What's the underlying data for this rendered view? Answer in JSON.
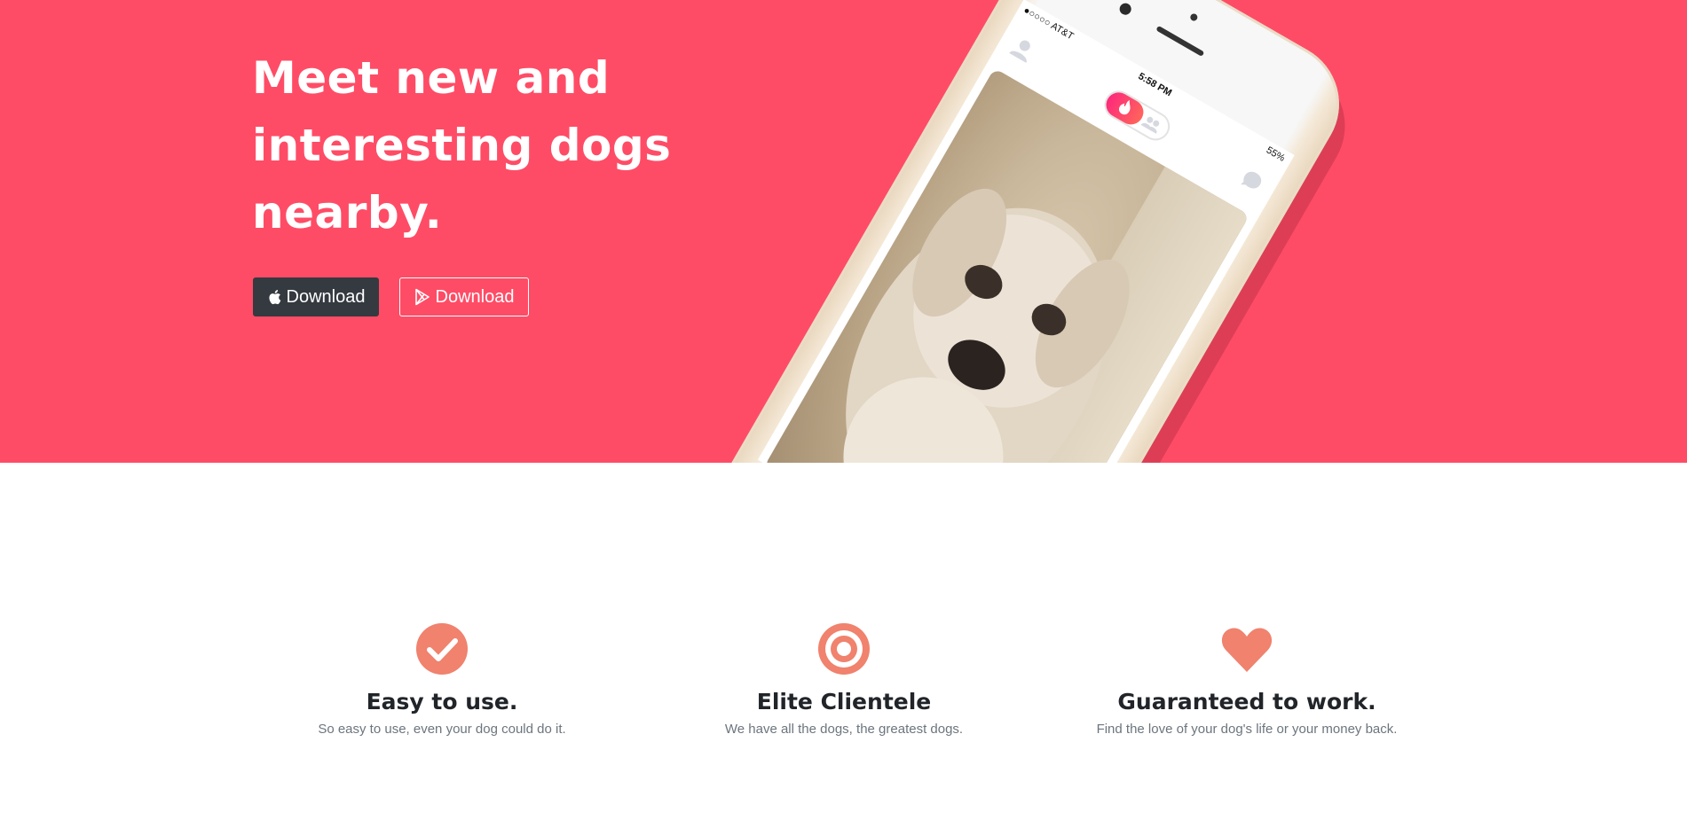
{
  "hero": {
    "headline_line1": "Meet new and",
    "headline_line2": "interesting dogs",
    "headline_line3": "nearby.",
    "background_color": "#ff4c66",
    "buttons": {
      "apple": {
        "label": "Download",
        "icon": "apple-icon"
      },
      "play": {
        "label": "Download",
        "icon": "google-play-icon"
      }
    }
  },
  "phone": {
    "status_bar": {
      "carrier": "●○○○○ AT&T",
      "time": "5:58 PM",
      "battery": "55%"
    },
    "icons": [
      "profile-icon",
      "flame-icon",
      "people-icon",
      "chat-icon"
    ]
  },
  "features": [
    {
      "icon": "check-circle-icon",
      "title": "Easy to use.",
      "text": "So easy to use, even your dog could do it."
    },
    {
      "icon": "target-icon",
      "title": "Elite Clientele",
      "text": "We have all the dogs, the greatest dogs."
    },
    {
      "icon": "heart-icon",
      "title": "Guaranteed to work.",
      "text": "Find the love of your dog's life or your money back."
    }
  ],
  "colors": {
    "accent": "#f0826e",
    "dark_button": "#343a40",
    "title_text": "#212529",
    "muted_text": "#6c757d"
  }
}
